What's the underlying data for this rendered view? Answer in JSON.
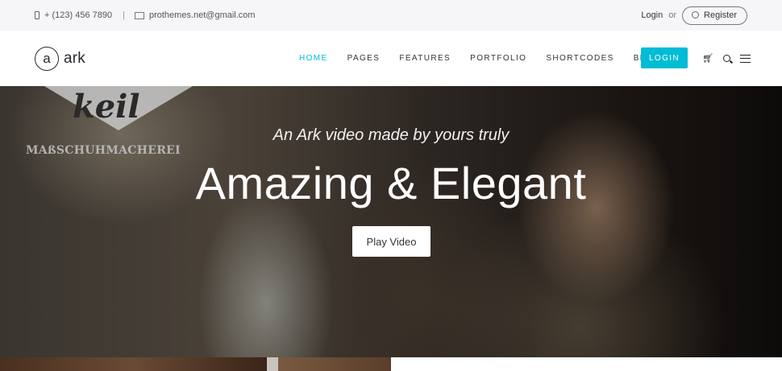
{
  "topbar": {
    "phone": "+ (123) 456 7890",
    "separator": "|",
    "email": "prothemes.net@gmail.com",
    "login": "Login",
    "or": "or",
    "register": "Register"
  },
  "header": {
    "logo_mark": "a",
    "logo_text": "ark",
    "nav": [
      "HOME",
      "PAGES",
      "FEATURES",
      "PORTFOLIO",
      "SHORTCODES",
      "BLOG"
    ],
    "active_nav": "HOME",
    "login_button": "LOGIN",
    "icons": [
      "cart-icon",
      "search-icon",
      "menu-icon"
    ]
  },
  "hero": {
    "sign_word": "keil",
    "sign_sub": "MAßSCHUHMACHEREI",
    "tagline": "An Ark video made by yours truly",
    "title": "Amazing & Elegant",
    "play_button": "Play Video"
  },
  "colors": {
    "accent": "#00bcd4",
    "topbar_bg": "#f6f6f8",
    "text": "#34343c"
  }
}
